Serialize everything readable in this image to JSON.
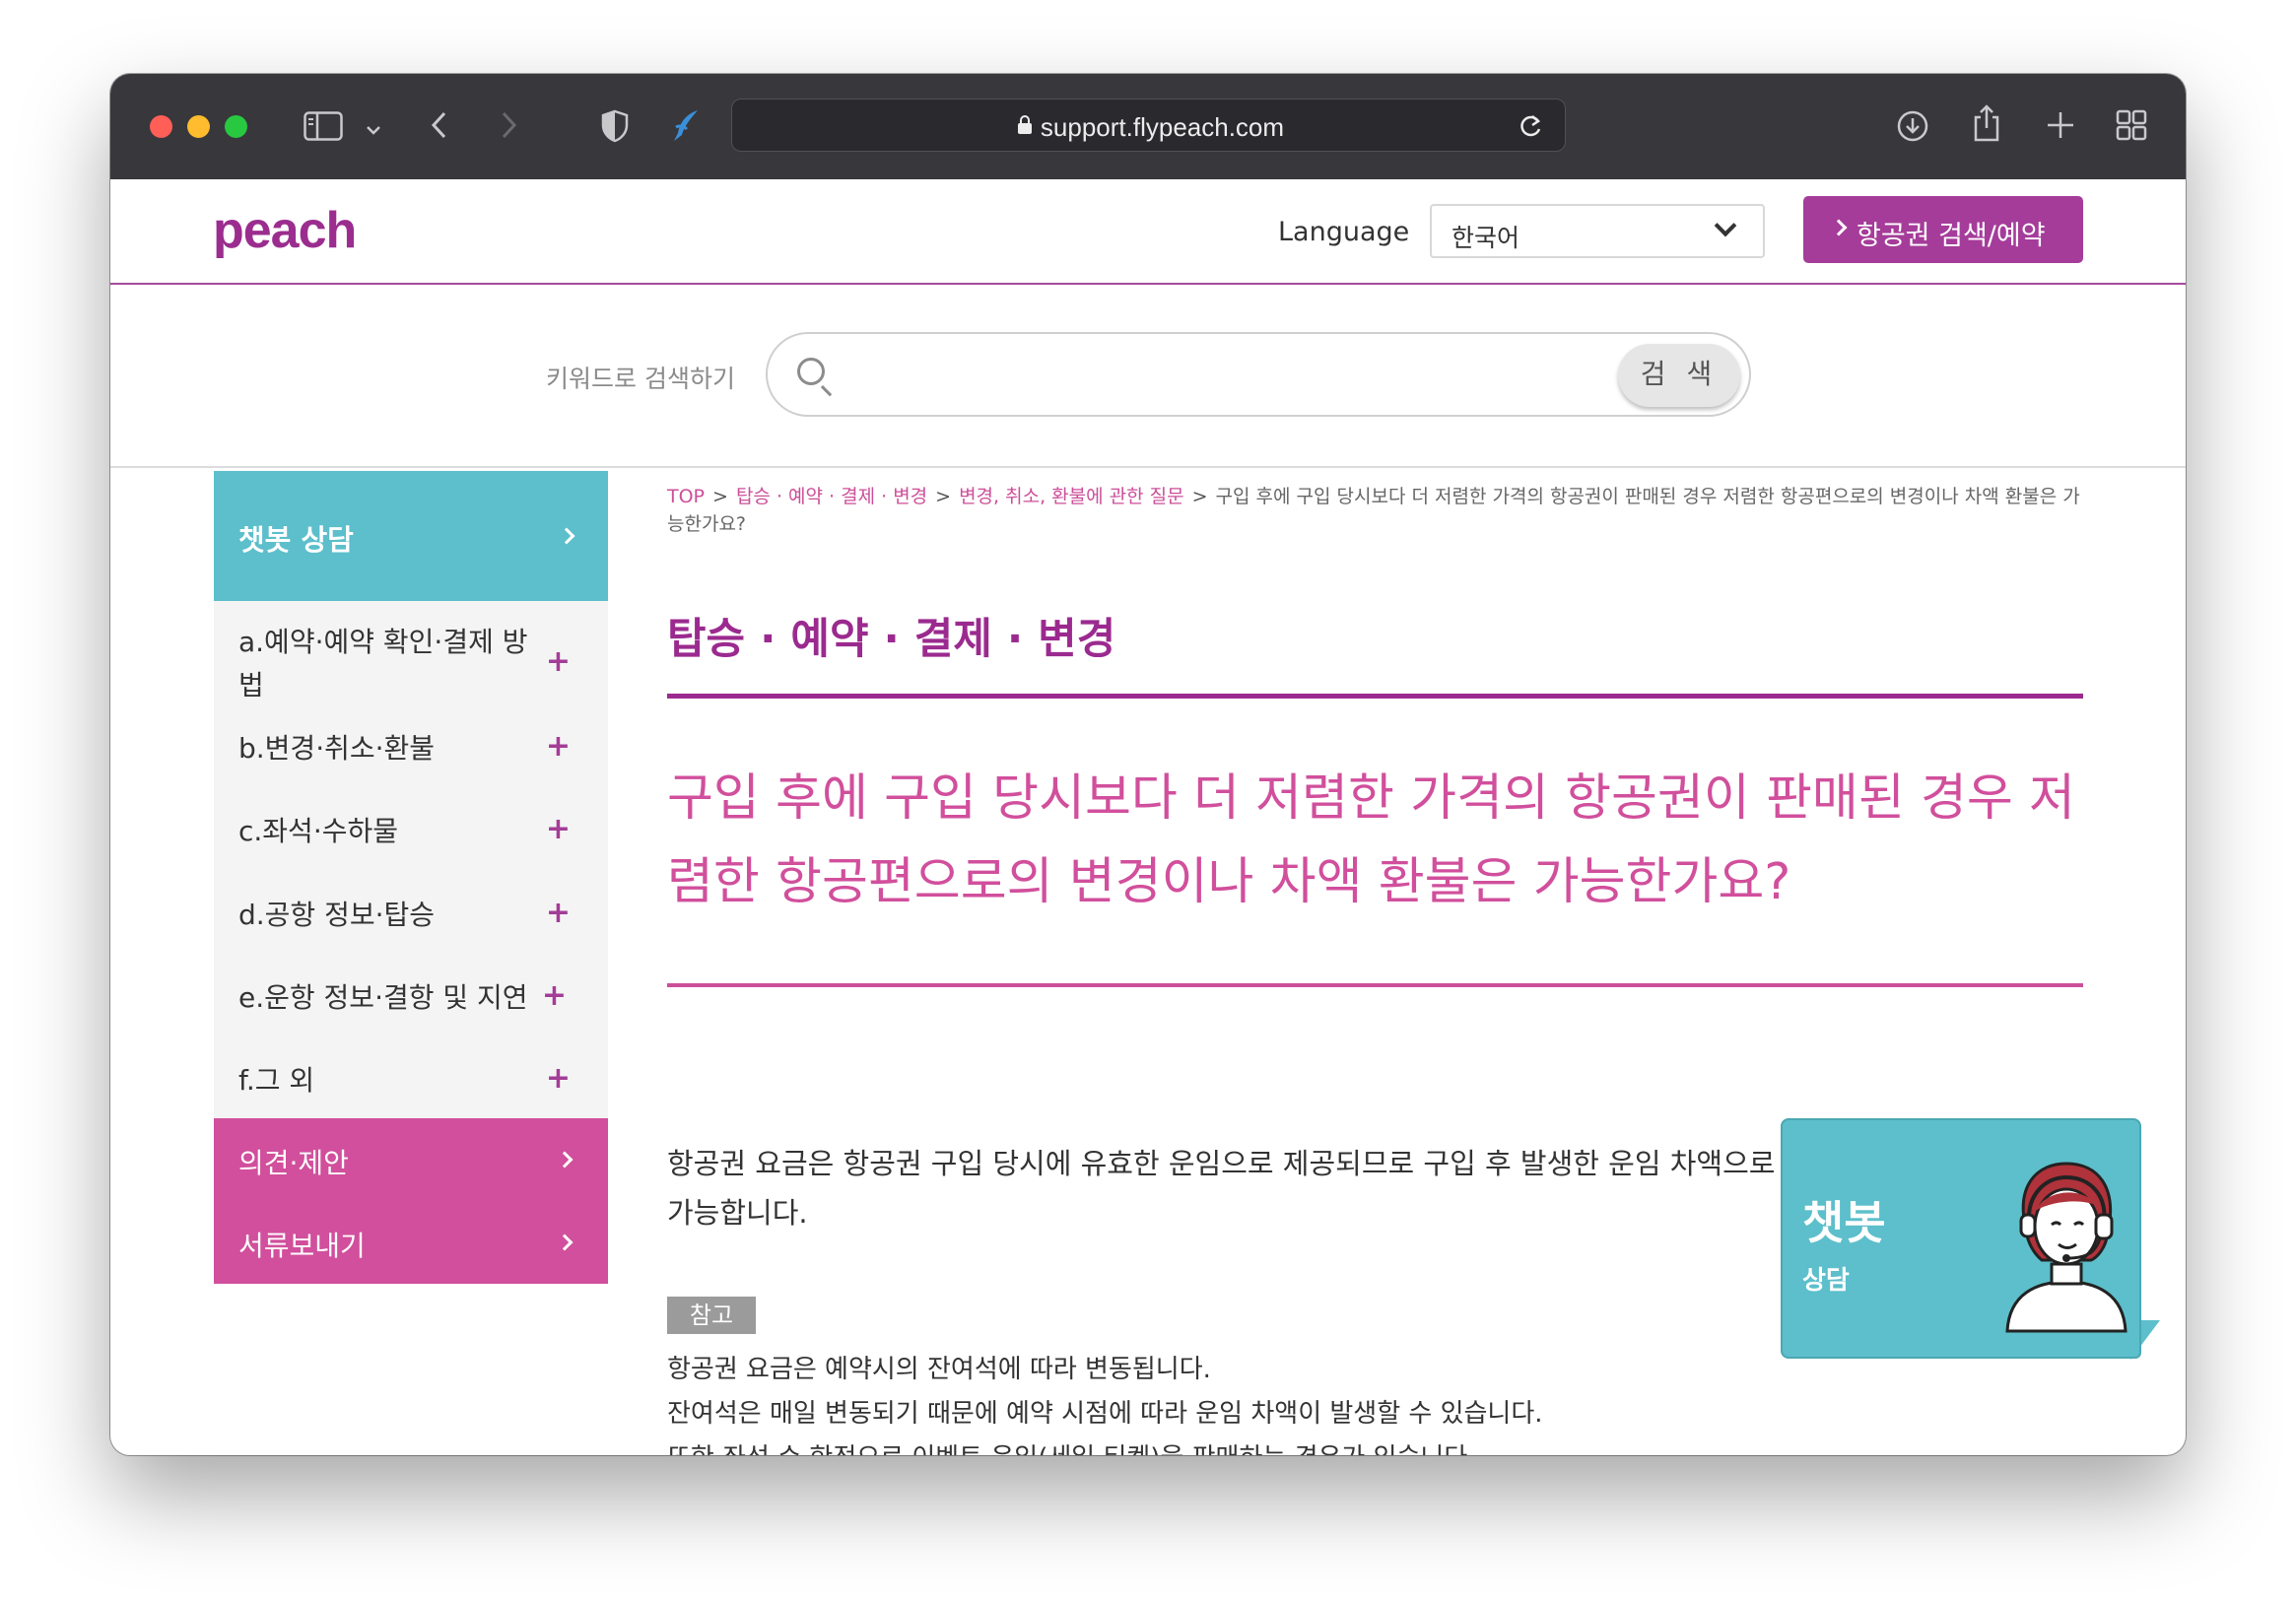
{
  "browser": {
    "url": "support.flypeach.com"
  },
  "header": {
    "logo": "peach",
    "language_label": "Language",
    "language_value": "한국어",
    "book_button": "항공권 검색/예약"
  },
  "search": {
    "label": "키워드로 검색하기",
    "button": "검 색",
    "value": ""
  },
  "sidebar": {
    "chat": "챗봇 상담",
    "categories": [
      {
        "label": "a.예약·예약 확인·결제 방\n법"
      },
      {
        "label": "b.변경·취소·환불"
      },
      {
        "label": "c.좌석·수하물"
      },
      {
        "label": "d.공항 정보·탑승"
      },
      {
        "label": "e.운항 정보·결항 및 지연"
      },
      {
        "label": "f.그 외"
      }
    ],
    "plus": "+",
    "pink_items": [
      "의견·제안",
      "서류보내기"
    ]
  },
  "breadcrumb": {
    "items": [
      "TOP",
      "탑승 · 예약 · 결제 · 변경",
      "변경, 취소, 환불에 관한 질문"
    ],
    "separator": ">",
    "current": "구입 후에 구입 당시보다 더 저렴한 가격의 항공권이 판매된 경우 저렴한 항공편으로의 변경이나 차액 환불은 가능한가요?"
  },
  "section_title": "탑승 · 예약 · 결제 · 변경",
  "question": "구입 후에 구입 당시보다 더 저렴한 가격의 항공권이 판매된 경우 저렴한 항공편으로의 변경이나 차액 환불은 가능한가요?",
  "answer": "항공권 요금은 항공권 구입 당시에 유효한 운임으로 제공되므로 구입 후 발생한 운임 차액으로 인한 변경이나 환불은 불가능합니다.",
  "note": {
    "badge": "참고",
    "lines": [
      "항공권 요금은 예약시의 잔여석에 따라 변동됩니다.",
      "잔여석은 매일 변동되기 때문에 예약 시점에 따라 운임 차액이 발생할 수 있습니다.",
      "또한 좌석 수 한정으로 이벤트 운임(세일 티켓)을 판매하는 경우가 있습니다."
    ]
  },
  "chatbot": {
    "title": "챗봇",
    "subtitle": "상담"
  },
  "colors": {
    "brand_purple": "#9b2a8f",
    "brand_pink": "#d14f9c",
    "chat_teal": "#5cbfcb"
  }
}
